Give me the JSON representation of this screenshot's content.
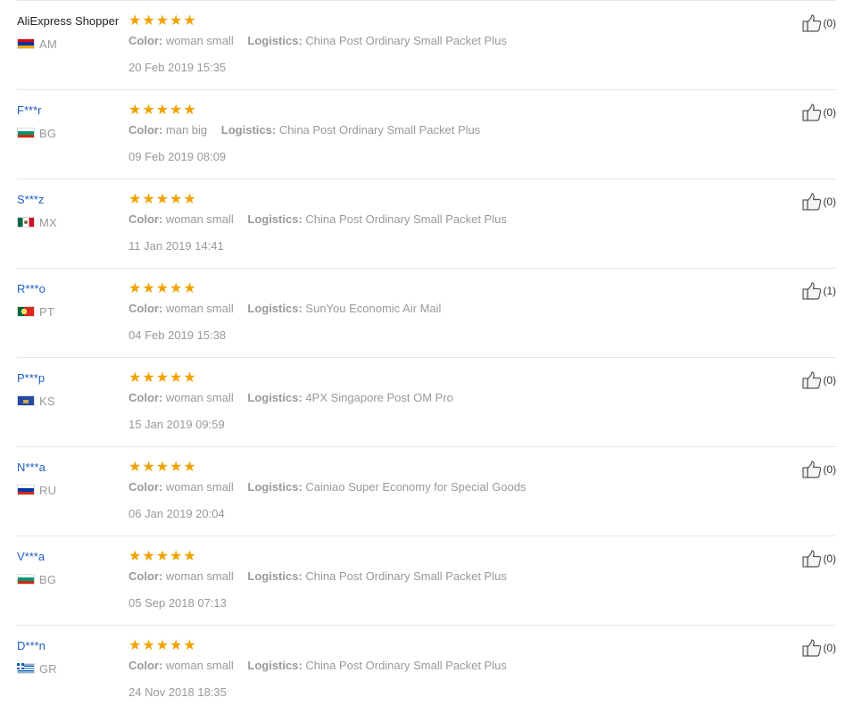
{
  "labels": {
    "color": "Color:",
    "logistics": "Logistics:"
  },
  "colors": {
    "star": "#f0a200",
    "buyer_link": "#1d5fbd",
    "muted_text": "#999999",
    "divider": "#e8e8e8"
  },
  "icons": {
    "rating": "star-icon",
    "helpful": "thumbs-up-icon",
    "country": "flag-icon"
  },
  "reviews": [
    {
      "buyer": "AliExpress Shopper",
      "country": "AM",
      "rating": 5,
      "color": "woman small",
      "logistics": "China Post Ordinary Small Packet Plus",
      "date": "20 Feb 2019 15:35",
      "helpful": "(0)"
    },
    {
      "buyer": "F***r",
      "country": "BG",
      "rating": 5,
      "color": "man big",
      "logistics": "China Post Ordinary Small Packet Plus",
      "date": "09 Feb 2019 08:09",
      "helpful": "(0)"
    },
    {
      "buyer": "S***z",
      "country": "MX",
      "rating": 5,
      "color": "woman small",
      "logistics": "China Post Ordinary Small Packet Plus",
      "date": "11 Jan 2019 14:41",
      "helpful": "(0)"
    },
    {
      "buyer": "R***o",
      "country": "PT",
      "rating": 5,
      "color": "woman small",
      "logistics": "SunYou Economic Air Mail",
      "date": "04 Feb 2019 15:38",
      "helpful": "(1)"
    },
    {
      "buyer": "P***p",
      "country": "KS",
      "rating": 5,
      "color": "woman small",
      "logistics": "4PX Singapore Post OM Pro",
      "date": "15 Jan 2019 09:59",
      "helpful": "(0)"
    },
    {
      "buyer": "N***a",
      "country": "RU",
      "rating": 5,
      "color": "woman small",
      "logistics": "Cainiao Super Economy for Special Goods",
      "date": "06 Jan 2019 20:04",
      "helpful": "(0)"
    },
    {
      "buyer": "V***a",
      "country": "BG",
      "rating": 5,
      "color": "woman small",
      "logistics": "China Post Ordinary Small Packet Plus",
      "date": "05 Sep 2018 07:13",
      "helpful": "(0)"
    },
    {
      "buyer": "D***n",
      "country": "GR",
      "rating": 5,
      "color": "woman small",
      "logistics": "China Post Ordinary Small Packet Plus",
      "date": "24 Nov 2018 18:35",
      "helpful": "(0)"
    }
  ]
}
